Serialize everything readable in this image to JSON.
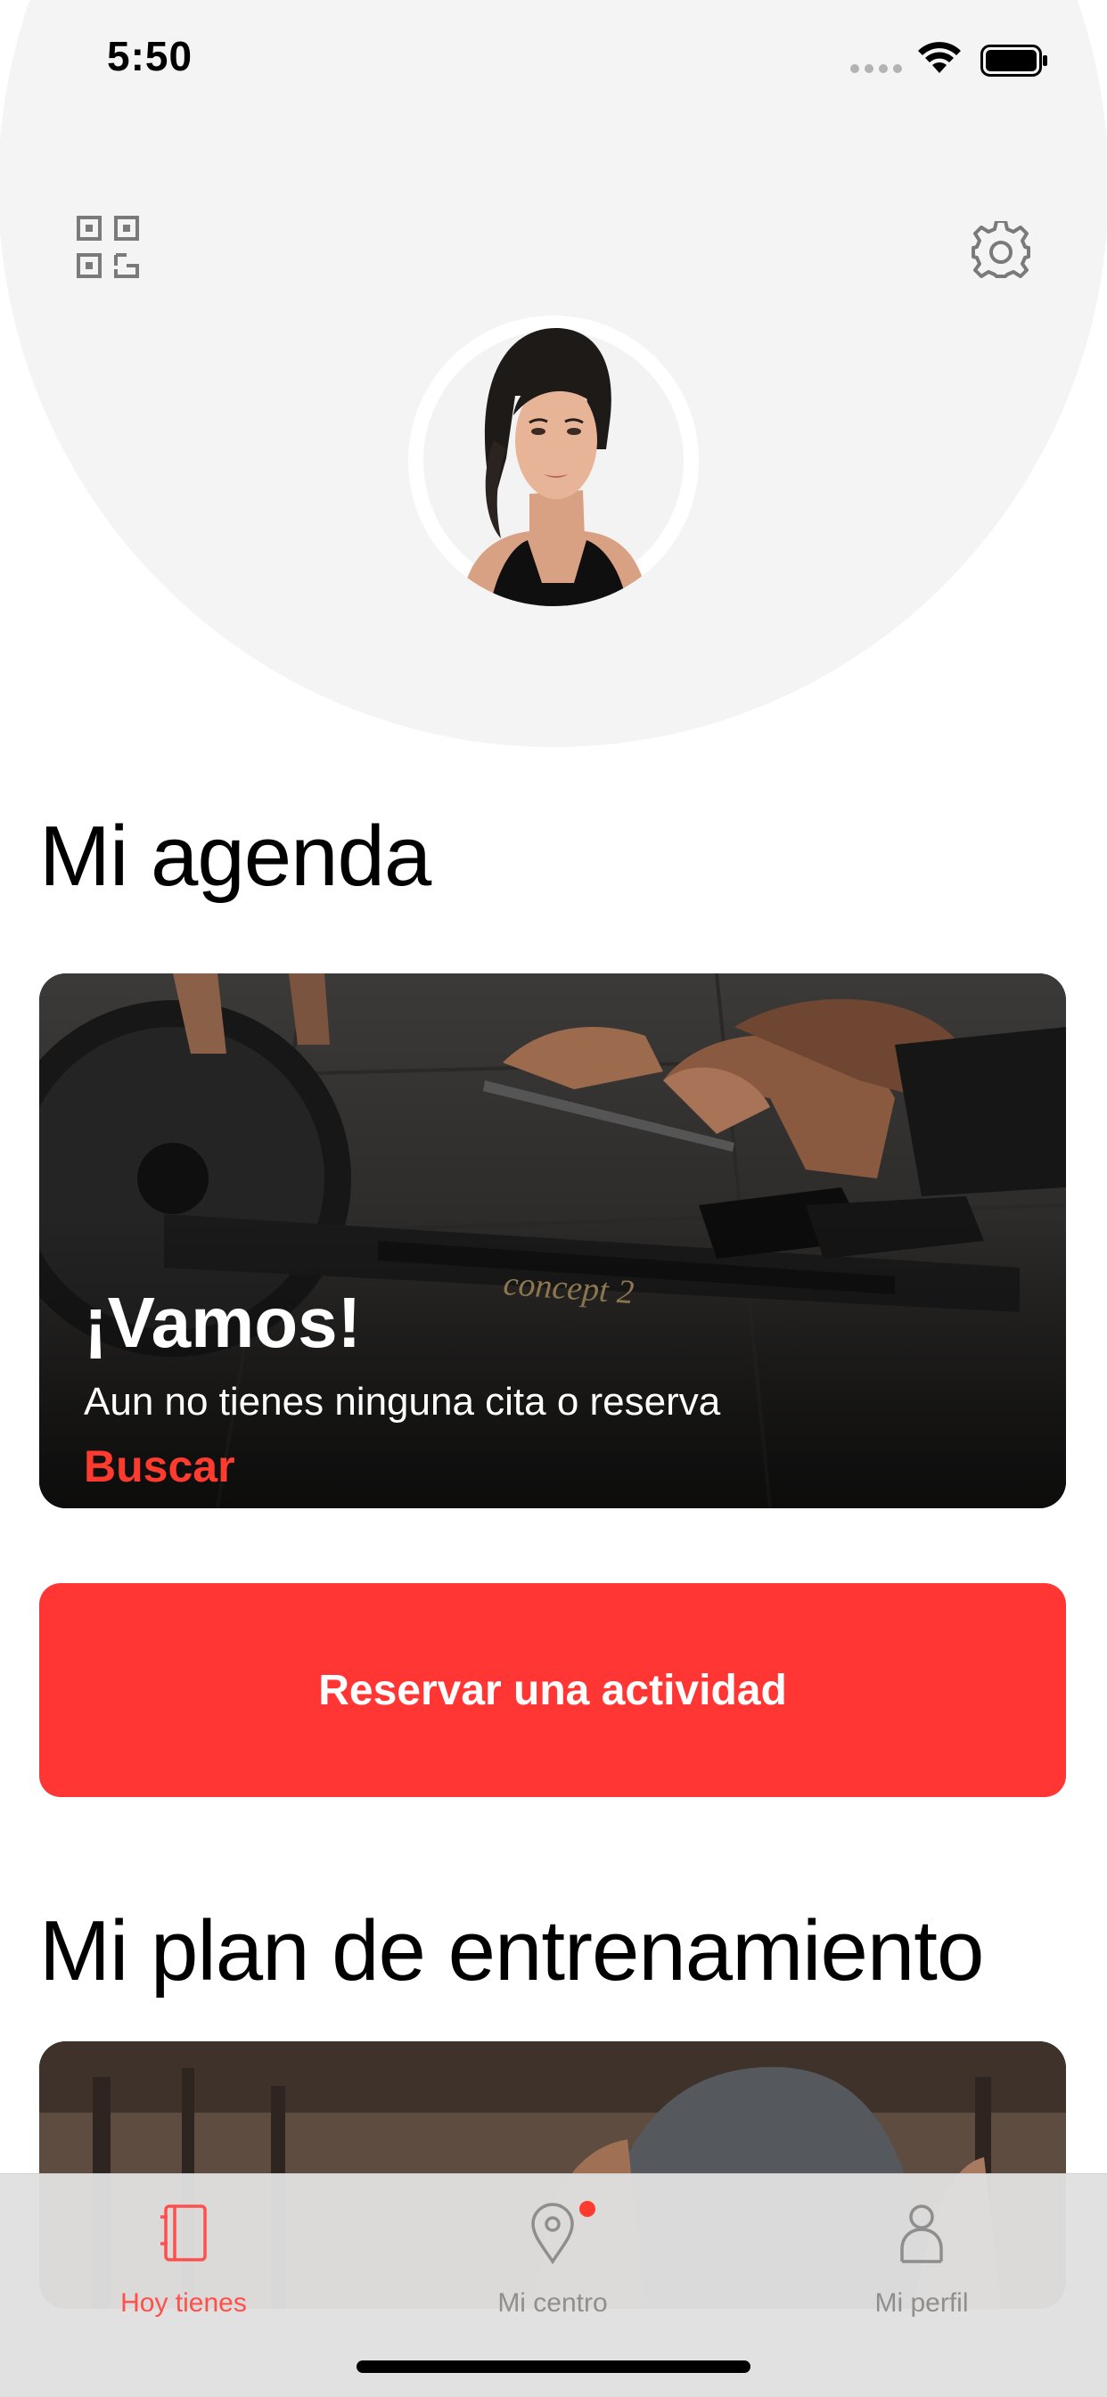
{
  "status_bar": {
    "time": "5:50"
  },
  "agenda": {
    "title": "Mi agenda",
    "card": {
      "heading": "¡Vamos!",
      "subtext": "Aun no tienes ninguna cita o reserva",
      "link": "Buscar"
    },
    "reserve_button": "Reservar una actividad"
  },
  "plan": {
    "title": "Mi plan de entrenamiento"
  },
  "tab_bar": {
    "items": [
      {
        "label": "Hoy tienes",
        "icon": "notebook-icon",
        "active": true
      },
      {
        "label": "Mi centro",
        "icon": "location-pin-icon",
        "badge": true
      },
      {
        "label": "Mi perfil",
        "icon": "person-icon"
      }
    ]
  },
  "colors": {
    "accent": "#ff3634",
    "header_bg": "#f4f4f4",
    "tab_active": "#ff4f4b",
    "tab_inactive": "#8e8e8e"
  }
}
